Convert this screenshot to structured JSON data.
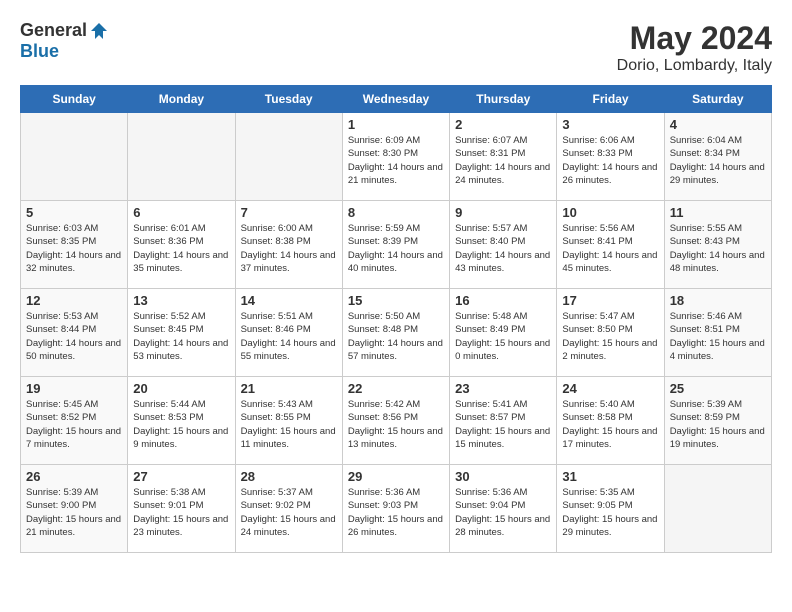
{
  "header": {
    "logo_general": "General",
    "logo_blue": "Blue",
    "month": "May 2024",
    "location": "Dorio, Lombardy, Italy"
  },
  "days_of_week": [
    "Sunday",
    "Monday",
    "Tuesday",
    "Wednesday",
    "Thursday",
    "Friday",
    "Saturday"
  ],
  "weeks": [
    [
      {
        "day": "",
        "info": "",
        "empty": true
      },
      {
        "day": "",
        "info": "",
        "empty": true
      },
      {
        "day": "",
        "info": "",
        "empty": true
      },
      {
        "day": "1",
        "info": "Sunrise: 6:09 AM\nSunset: 8:30 PM\nDaylight: 14 hours\nand 21 minutes.",
        "empty": false
      },
      {
        "day": "2",
        "info": "Sunrise: 6:07 AM\nSunset: 8:31 PM\nDaylight: 14 hours\nand 24 minutes.",
        "empty": false
      },
      {
        "day": "3",
        "info": "Sunrise: 6:06 AM\nSunset: 8:33 PM\nDaylight: 14 hours\nand 26 minutes.",
        "empty": false
      },
      {
        "day": "4",
        "info": "Sunrise: 6:04 AM\nSunset: 8:34 PM\nDaylight: 14 hours\nand 29 minutes.",
        "empty": false
      }
    ],
    [
      {
        "day": "5",
        "info": "Sunrise: 6:03 AM\nSunset: 8:35 PM\nDaylight: 14 hours\nand 32 minutes.",
        "empty": false
      },
      {
        "day": "6",
        "info": "Sunrise: 6:01 AM\nSunset: 8:36 PM\nDaylight: 14 hours\nand 35 minutes.",
        "empty": false
      },
      {
        "day": "7",
        "info": "Sunrise: 6:00 AM\nSunset: 8:38 PM\nDaylight: 14 hours\nand 37 minutes.",
        "empty": false
      },
      {
        "day": "8",
        "info": "Sunrise: 5:59 AM\nSunset: 8:39 PM\nDaylight: 14 hours\nand 40 minutes.",
        "empty": false
      },
      {
        "day": "9",
        "info": "Sunrise: 5:57 AM\nSunset: 8:40 PM\nDaylight: 14 hours\nand 43 minutes.",
        "empty": false
      },
      {
        "day": "10",
        "info": "Sunrise: 5:56 AM\nSunset: 8:41 PM\nDaylight: 14 hours\nand 45 minutes.",
        "empty": false
      },
      {
        "day": "11",
        "info": "Sunrise: 5:55 AM\nSunset: 8:43 PM\nDaylight: 14 hours\nand 48 minutes.",
        "empty": false
      }
    ],
    [
      {
        "day": "12",
        "info": "Sunrise: 5:53 AM\nSunset: 8:44 PM\nDaylight: 14 hours\nand 50 minutes.",
        "empty": false
      },
      {
        "day": "13",
        "info": "Sunrise: 5:52 AM\nSunset: 8:45 PM\nDaylight: 14 hours\nand 53 minutes.",
        "empty": false
      },
      {
        "day": "14",
        "info": "Sunrise: 5:51 AM\nSunset: 8:46 PM\nDaylight: 14 hours\nand 55 minutes.",
        "empty": false
      },
      {
        "day": "15",
        "info": "Sunrise: 5:50 AM\nSunset: 8:48 PM\nDaylight: 14 hours\nand 57 minutes.",
        "empty": false
      },
      {
        "day": "16",
        "info": "Sunrise: 5:48 AM\nSunset: 8:49 PM\nDaylight: 15 hours\nand 0 minutes.",
        "empty": false
      },
      {
        "day": "17",
        "info": "Sunrise: 5:47 AM\nSunset: 8:50 PM\nDaylight: 15 hours\nand 2 minutes.",
        "empty": false
      },
      {
        "day": "18",
        "info": "Sunrise: 5:46 AM\nSunset: 8:51 PM\nDaylight: 15 hours\nand 4 minutes.",
        "empty": false
      }
    ],
    [
      {
        "day": "19",
        "info": "Sunrise: 5:45 AM\nSunset: 8:52 PM\nDaylight: 15 hours\nand 7 minutes.",
        "empty": false
      },
      {
        "day": "20",
        "info": "Sunrise: 5:44 AM\nSunset: 8:53 PM\nDaylight: 15 hours\nand 9 minutes.",
        "empty": false
      },
      {
        "day": "21",
        "info": "Sunrise: 5:43 AM\nSunset: 8:55 PM\nDaylight: 15 hours\nand 11 minutes.",
        "empty": false
      },
      {
        "day": "22",
        "info": "Sunrise: 5:42 AM\nSunset: 8:56 PM\nDaylight: 15 hours\nand 13 minutes.",
        "empty": false
      },
      {
        "day": "23",
        "info": "Sunrise: 5:41 AM\nSunset: 8:57 PM\nDaylight: 15 hours\nand 15 minutes.",
        "empty": false
      },
      {
        "day": "24",
        "info": "Sunrise: 5:40 AM\nSunset: 8:58 PM\nDaylight: 15 hours\nand 17 minutes.",
        "empty": false
      },
      {
        "day": "25",
        "info": "Sunrise: 5:39 AM\nSunset: 8:59 PM\nDaylight: 15 hours\nand 19 minutes.",
        "empty": false
      }
    ],
    [
      {
        "day": "26",
        "info": "Sunrise: 5:39 AM\nSunset: 9:00 PM\nDaylight: 15 hours\nand 21 minutes.",
        "empty": false
      },
      {
        "day": "27",
        "info": "Sunrise: 5:38 AM\nSunset: 9:01 PM\nDaylight: 15 hours\nand 23 minutes.",
        "empty": false
      },
      {
        "day": "28",
        "info": "Sunrise: 5:37 AM\nSunset: 9:02 PM\nDaylight: 15 hours\nand 24 minutes.",
        "empty": false
      },
      {
        "day": "29",
        "info": "Sunrise: 5:36 AM\nSunset: 9:03 PM\nDaylight: 15 hours\nand 26 minutes.",
        "empty": false
      },
      {
        "day": "30",
        "info": "Sunrise: 5:36 AM\nSunset: 9:04 PM\nDaylight: 15 hours\nand 28 minutes.",
        "empty": false
      },
      {
        "day": "31",
        "info": "Sunrise: 5:35 AM\nSunset: 9:05 PM\nDaylight: 15 hours\nand 29 minutes.",
        "empty": false
      },
      {
        "day": "",
        "info": "",
        "empty": true
      }
    ]
  ]
}
